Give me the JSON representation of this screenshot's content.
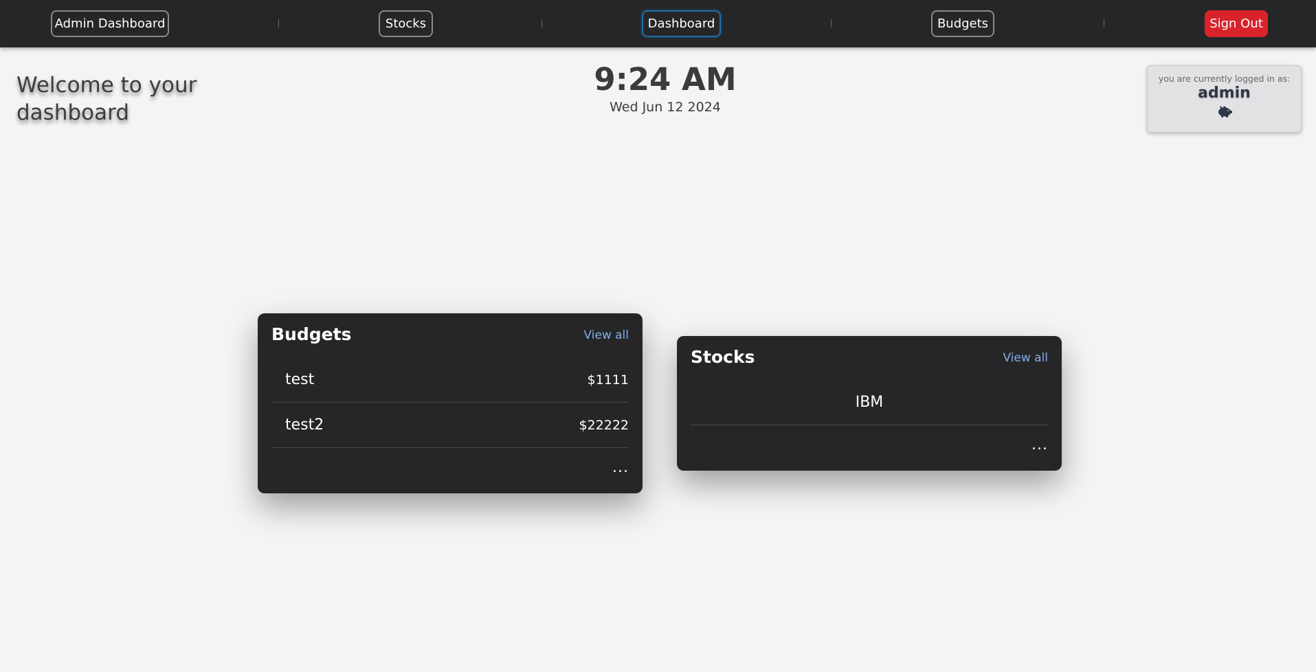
{
  "nav": {
    "admin_dashboard": "Admin Dashboard",
    "stocks": "Stocks",
    "dashboard": "Dashboard",
    "budgets": "Budgets",
    "sign_out": "Sign Out"
  },
  "header": {
    "welcome": "Welcome to your dashboard",
    "time": "9:24 AM",
    "date": "Wed Jun 12 2024"
  },
  "login": {
    "caption": "you are currently logged in as:",
    "username": "admin",
    "icon": "piggy-bank-icon"
  },
  "budgets_card": {
    "title": "Budgets",
    "view_all": "View all",
    "items": [
      {
        "name": "test",
        "amount": "$1111"
      },
      {
        "name": "test2",
        "amount": "$22222"
      }
    ],
    "more": "..."
  },
  "stocks_card": {
    "title": "Stocks",
    "view_all": "View all",
    "items": [
      {
        "symbol": "IBM"
      }
    ],
    "more": "..."
  },
  "colors": {
    "nav_bg": "#262628",
    "page_bg": "#f4f4f4",
    "card_bg": "#262628",
    "sign_out": "#d8232a",
    "active_border": "#1e6fa8",
    "link": "#7fb0e8"
  }
}
